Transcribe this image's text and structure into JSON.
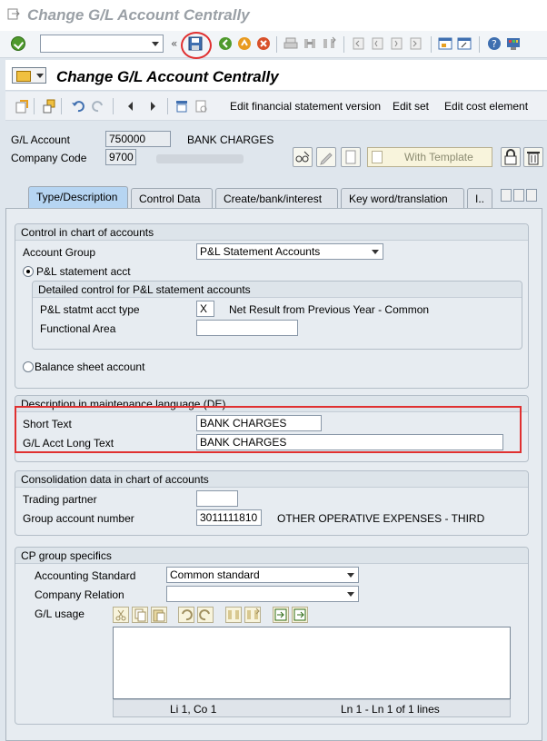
{
  "window": {
    "title": "Change G/L Account Centrally"
  },
  "app": {
    "title": "Change G/L Account Centrally"
  },
  "toolbar": {
    "items": [
      "Edit financial statement version",
      "Edit set",
      "Edit cost element"
    ]
  },
  "header": {
    "gl_account_label": "G/L Account",
    "gl_account_value": "750000",
    "gl_account_desc": "BANK CHARGES",
    "company_code_label": "Company Code",
    "company_code_value": "9700",
    "template_button": "With Template"
  },
  "tabs": [
    "Type/Description",
    "Control Data",
    "Create/bank/interest",
    "Key word/translation",
    "I.."
  ],
  "coa_control": {
    "title": "Control in chart of accounts",
    "account_group_label": "Account Group",
    "account_group_value": "P&L Statement Accounts",
    "pl_radio_label": "P&L statement acct",
    "detail_title": "Detailed control for P&L statement accounts",
    "pl_type_label": "P&L statmt acct type",
    "pl_type_value": "X",
    "pl_type_desc": "Net Result from Previous Year - Common",
    "functional_area_label": "Functional Area",
    "balance_radio_label": "Balance sheet account"
  },
  "description": {
    "title": "Description in maintenance language (DE)",
    "short_text_label": "Short Text",
    "short_text_value": "BANK CHARGES",
    "long_text_label": "G/L Acct Long Text",
    "long_text_value": "BANK CHARGES"
  },
  "consolidation": {
    "title": "Consolidation data in chart of accounts",
    "trading_partner_label": "Trading partner",
    "group_account_label": "Group account number",
    "group_account_value": "3011111810",
    "group_account_desc": "OTHER OPERATIVE EXPENSES - THIRD"
  },
  "cp_group": {
    "title": "CP group specifics",
    "accounting_standard_label": "Accounting Standard",
    "accounting_standard_value": "Common standard",
    "company_relation_label": "Company Relation",
    "gl_usage_label": "G/L usage",
    "status_position": "Li 1, Co 1",
    "status_lines": "Ln 1 - Ln 1 of 1 lines"
  }
}
